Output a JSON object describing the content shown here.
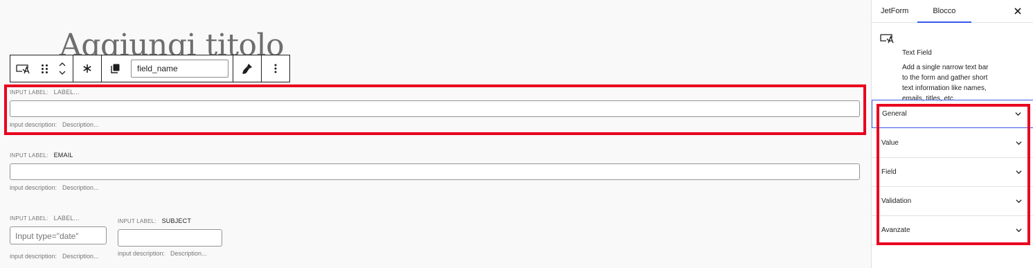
{
  "editor": {
    "title_placeholder": "Aggiungi titolo",
    "toolbar": {
      "field_name_value": "field_name",
      "block_icon": "text-field-icon",
      "drag_icon": "drag-handle-icon",
      "move_icon": "move-up-down-icon",
      "required_icon": "asterisk-icon",
      "copy_icon": "copy-icon",
      "style_icon": "brush-icon",
      "more_icon": "more-vertical-icon"
    },
    "fields": [
      {
        "label_prefix": "INPUT LABEL:",
        "label": "LABEL...",
        "desc_prefix": "input description:",
        "desc": "Description..."
      },
      {
        "label_prefix": "INPUT LABEL:",
        "label": "EMAIL",
        "desc_prefix": "input description:",
        "desc": "Description..."
      },
      {
        "label_prefix": "INPUT LABEL:",
        "label": "LABEL...",
        "placeholder": "Input type=\"date\"",
        "desc_prefix": "input description:",
        "desc": "Description..."
      },
      {
        "label_prefix": "INPUT LABEL:",
        "label": "SUBJECT",
        "desc_prefix": "input description:",
        "desc": "Description..."
      }
    ]
  },
  "sidebar": {
    "tabs": [
      {
        "label": "JetForm",
        "active": false
      },
      {
        "label": "Blocco",
        "active": true
      }
    ],
    "close_icon": "close-icon",
    "block": {
      "name": "Text Field",
      "description": "Add a single narrow text bar to the form and gather short text information like names, emails, titles, etc."
    },
    "panels": [
      {
        "label": "General"
      },
      {
        "label": "Value"
      },
      {
        "label": "Field"
      },
      {
        "label": "Validation"
      },
      {
        "label": "Avanzate"
      }
    ]
  },
  "colors": {
    "highlight": "#e8001f",
    "accent": "#3858e9"
  }
}
